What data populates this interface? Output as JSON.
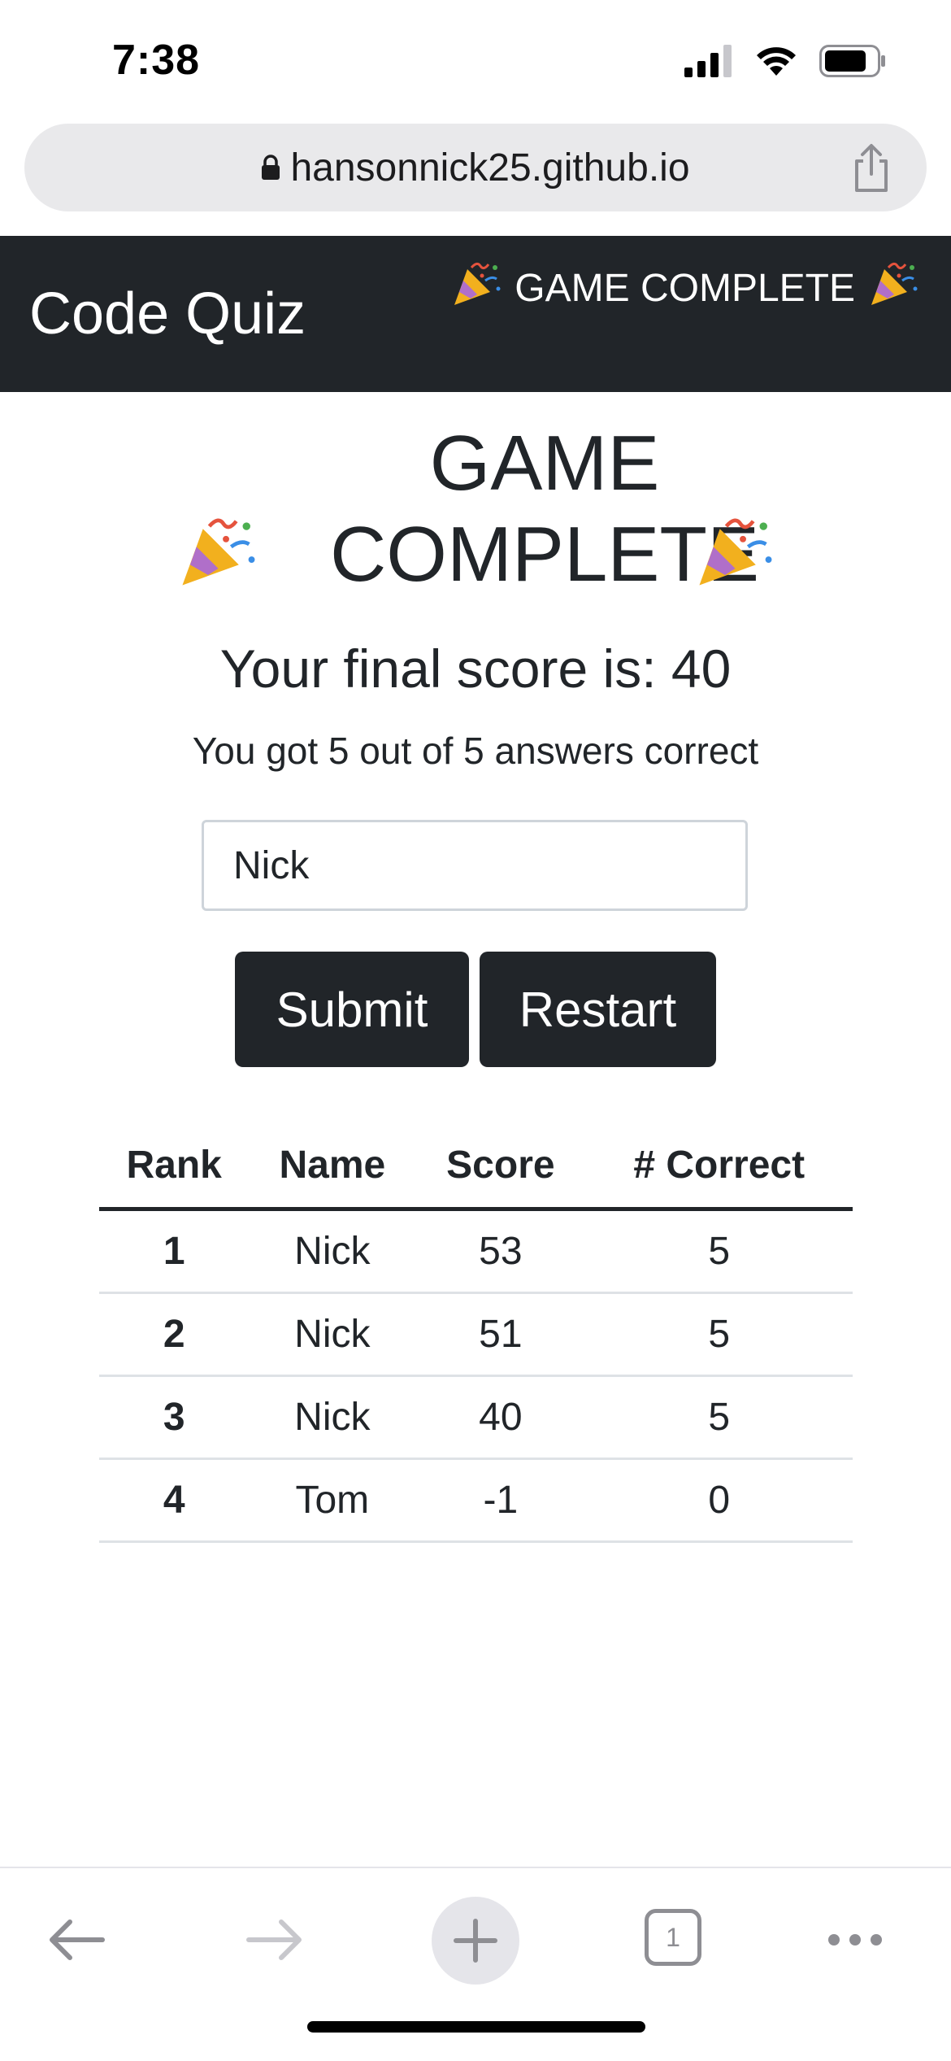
{
  "status": {
    "time": "7:38"
  },
  "browser": {
    "url": "hansonnick25.github.io",
    "tab_count": "1"
  },
  "nav": {
    "brand": "Code Quiz",
    "status": "GAME COMPLETE"
  },
  "result": {
    "title": "GAME COMPLETE",
    "final_score": "Your final score is: 40",
    "correct_summary": "You got 5 out of 5 answers correct"
  },
  "form": {
    "name_value": "Nick",
    "submit_label": "Submit",
    "restart_label": "Restart"
  },
  "leaderboard": {
    "headers": [
      "Rank",
      "Name",
      "Score",
      "# Correct"
    ],
    "rows": [
      [
        "1",
        "Nick",
        "53",
        "5"
      ],
      [
        "2",
        "Nick",
        "51",
        "5"
      ],
      [
        "3",
        "Nick",
        "40",
        "5"
      ],
      [
        "4",
        "Tom",
        "-1",
        "0"
      ]
    ]
  },
  "icons": {
    "party": "party-popper-icon",
    "lock": "lock-icon",
    "share": "share-icon",
    "back": "back-arrow-icon",
    "forward": "forward-arrow-icon",
    "new_tab": "plus-icon",
    "tabs": "tabs-icon",
    "more": "more-icon"
  }
}
